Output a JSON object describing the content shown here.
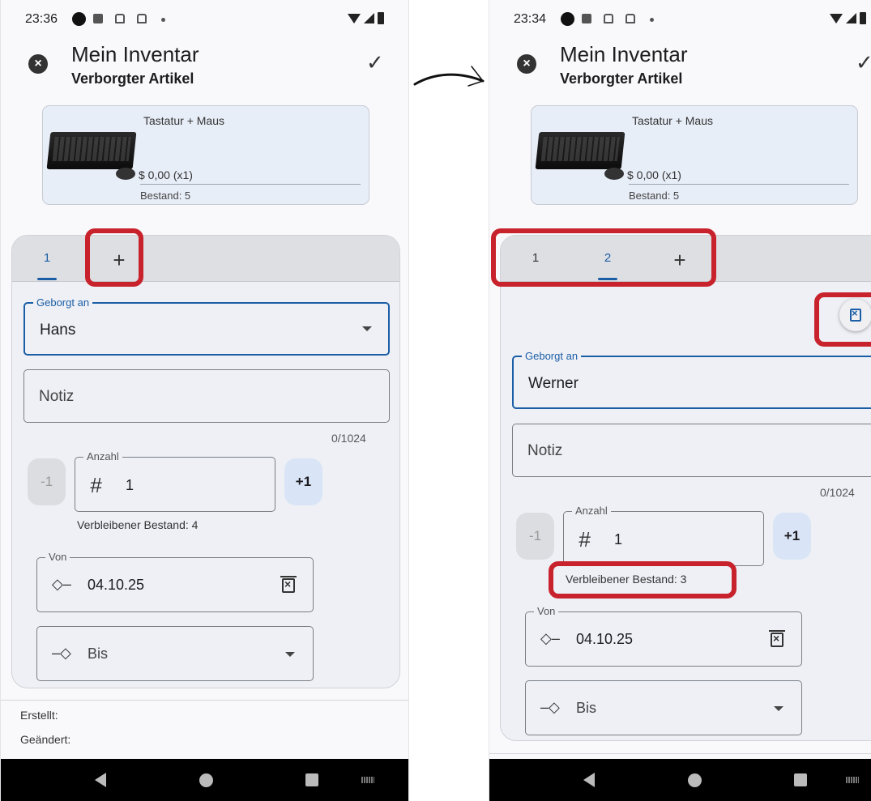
{
  "left_screen": {
    "status_time": "23:36",
    "title": "Mein Inventar",
    "subtitle": "Verborgter Artikel",
    "item": {
      "name": "Tastatur + Maus",
      "price": "$ 0,00   (x1)",
      "stock": "Bestand: 5"
    },
    "tabs": [
      "1"
    ],
    "add_tab": "+",
    "borrowed_to": {
      "label": "Geborgt an",
      "value": "Hans"
    },
    "note": {
      "placeholder": "Notiz",
      "counter": "0/1024"
    },
    "quantity": {
      "minus": "-1",
      "label": "Anzahl",
      "icon": "#",
      "value": "1",
      "plus": "+1",
      "remaining": "Verbleibener Bestand: 4"
    },
    "from": {
      "label": "Von",
      "icon": "◇–",
      "value": "04.10.25"
    },
    "until": {
      "icon": "–◇",
      "placeholder": "Bis"
    },
    "created_label": "Erstellt:",
    "changed_label": "Geändert:"
  },
  "right_screen": {
    "status_time": "23:34",
    "title": "Mein Inventar",
    "subtitle": "Verborgter Artikel",
    "item": {
      "name": "Tastatur + Maus",
      "price": "$ 0,00   (x1)",
      "stock": "Bestand: 5"
    },
    "tabs": [
      "1",
      "2"
    ],
    "add_tab": "+",
    "borrowed_to": {
      "label": "Geborgt an",
      "value": "Werner"
    },
    "note": {
      "placeholder": "Notiz",
      "counter": "0/1024"
    },
    "quantity": {
      "minus": "-1",
      "label": "Anzahl",
      "icon": "#",
      "value": "1",
      "plus": "+1",
      "remaining": "Verbleibener Bestand: 3"
    },
    "from": {
      "label": "Von",
      "icon": "◇–",
      "value": "04.10.25"
    },
    "until": {
      "icon": "–◇",
      "placeholder": "Bis"
    }
  },
  "colors": {
    "accent": "#1c5ea5",
    "highlight": "#c8232c"
  },
  "icons": [
    "close-icon",
    "check-icon",
    "dropdown-arrow-icon",
    "date-start-icon",
    "date-end-icon",
    "delete-date-icon",
    "delete-tab-icon",
    "hash-icon"
  ]
}
